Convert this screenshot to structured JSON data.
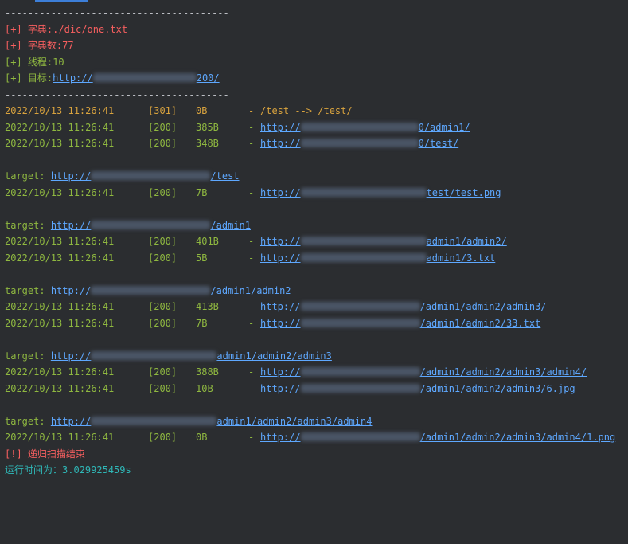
{
  "separator": "---------------------------------------",
  "dict": {
    "prefix": "[+] ",
    "label": "字典:",
    "value": "./dic/one.txt"
  },
  "dict_count": {
    "prefix": "[+] ",
    "label": "字典数:",
    "value": "77"
  },
  "threads": {
    "prefix": "[+] ",
    "label": "线程:",
    "value": "10"
  },
  "target_line": {
    "prefix": "[+] ",
    "label": "目标:",
    "url_head": "http://",
    "url_tail": "200/"
  },
  "results": [
    {
      "ts": "2022/10/13 11:26:41",
      "status": "[301]",
      "size": "0B",
      "dash": "-",
      "text": "/test --> /test/"
    },
    {
      "ts": "2022/10/13 11:26:41",
      "status": "[200]",
      "size": "385B",
      "dash": "-",
      "url_head": "http://",
      "url_tail": "0/admin1/"
    },
    {
      "ts": "2022/10/13 11:26:41",
      "status": "[200]",
      "size": "348B",
      "dash": "-",
      "url_head": "http://",
      "url_tail": "0/test/"
    }
  ],
  "group1": {
    "target_label": "target:",
    "target_head": "http://",
    "target_tail": "/test",
    "rows": [
      {
        "ts": "2022/10/13 11:26:41",
        "status": "[200]",
        "size": "7B",
        "dash": "-",
        "url_head": "http://",
        "url_tail": "test/test.png"
      }
    ]
  },
  "group2": {
    "target_label": "target:",
    "target_head": "http://",
    "target_tail": "/admin1",
    "rows": [
      {
        "ts": "2022/10/13 11:26:41",
        "status": "[200]",
        "size": "401B",
        "dash": "-",
        "url_head": "http://",
        "url_tail": "admin1/admin2/"
      },
      {
        "ts": "2022/10/13 11:26:41",
        "status": "[200]",
        "size": "5B",
        "dash": "-",
        "url_head": "http://",
        "url_tail": "admin1/3.txt"
      }
    ]
  },
  "group3": {
    "target_label": "target:",
    "target_head": "http://",
    "target_tail": "/admin1/admin2",
    "rows": [
      {
        "ts": "2022/10/13 11:26:41",
        "status": "[200]",
        "size": "413B",
        "dash": "-",
        "url_head": "http://",
        "url_tail": "/admin1/admin2/admin3/"
      },
      {
        "ts": "2022/10/13 11:26:41",
        "status": "[200]",
        "size": "7B",
        "dash": "-",
        "url_head": "http://",
        "url_tail": "/admin1/admin2/33.txt"
      }
    ]
  },
  "group4": {
    "target_label": "target:",
    "target_head": "http://",
    "target_tail": "admin1/admin2/admin3",
    "rows": [
      {
        "ts": "2022/10/13 11:26:41",
        "status": "[200]",
        "size": "388B",
        "dash": "-",
        "url_head": "http://",
        "url_tail": "/admin1/admin2/admin3/admin4/"
      },
      {
        "ts": "2022/10/13 11:26:41",
        "status": "[200]",
        "size": "10B",
        "dash": "-",
        "url_head": "http://",
        "url_tail": "/admin1/admin2/admin3/6.jpg"
      }
    ]
  },
  "group5": {
    "target_label": "target:",
    "target_head": "http://",
    "target_tail": "admin1/admin2/admin3/admin4",
    "rows": [
      {
        "ts": "2022/10/13 11:26:41",
        "status": "[200]",
        "size": "0B",
        "dash": "-",
        "url_head": "http://",
        "url_tail": "/admin1/admin2/admin3/admin4/1.png"
      }
    ]
  },
  "finish": {
    "prefix": "[!] ",
    "text": "递归扫描结束"
  },
  "runtime": {
    "label": "运行时间为：",
    "value": "3.029925459s"
  },
  "colors": {
    "background": "#2b2d30",
    "red": "#f75f5f",
    "green": "#8fb840",
    "orange": "#d9a33e",
    "cyan": "#2fb7b7",
    "link": "#5ea8ff"
  }
}
